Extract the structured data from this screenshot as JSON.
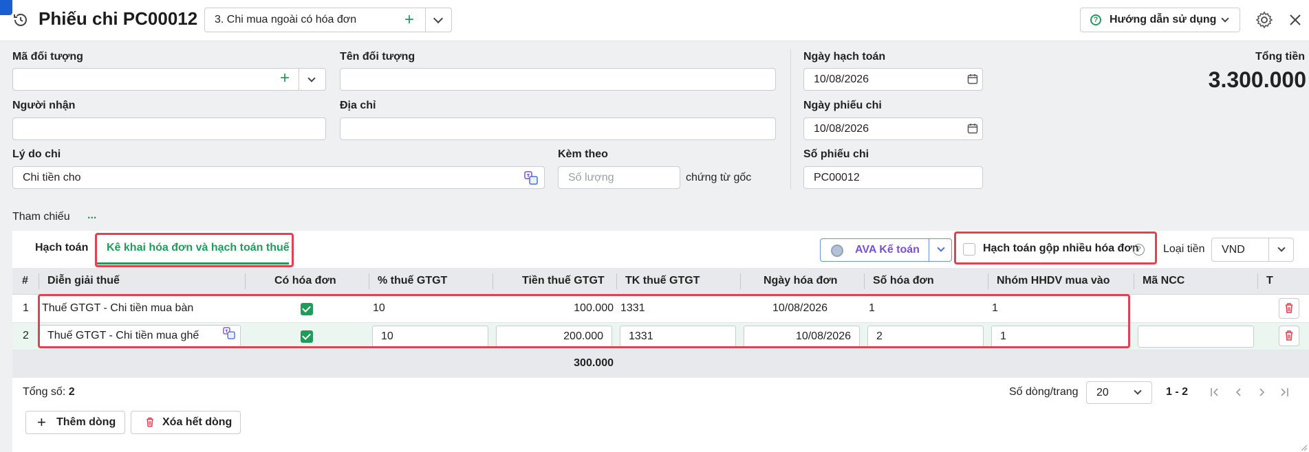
{
  "header": {
    "title": "Phiếu chi PC00012",
    "voucher_type": "3. Chi mua ngoài có hóa đơn",
    "help_label": "Hướng dẫn sử dụng"
  },
  "form": {
    "ma_doi_tuong_label": "Mã đối tượng",
    "ma_doi_tuong_value": "",
    "ten_doi_tuong_label": "Tên đối tượng",
    "ten_doi_tuong_value": "",
    "nguoi_nhan_label": "Người nhận",
    "nguoi_nhan_value": "",
    "dia_chi_label": "Địa chỉ",
    "dia_chi_value": "",
    "ly_do_chi_label": "Lý do chi",
    "ly_do_chi_value": "Chi tiền cho",
    "kem_theo_label": "Kèm theo",
    "kem_theo_placeholder": "Số lượng",
    "chung_tu_goc": "chứng từ gốc",
    "ngay_hach_toan_label": "Ngày hạch toán",
    "ngay_hach_toan_value": "10/08/2026",
    "ngay_phieu_chi_label": "Ngày phiếu chi",
    "ngay_phieu_chi_value": "10/08/2026",
    "so_phieu_chi_label": "Số phiếu chi",
    "so_phieu_chi_value": "PC00012",
    "tong_tien_label": "Tổng tiền",
    "tong_tien_value": "3.300.000",
    "tham_chieu_label": "Tham chiếu",
    "tham_chieu_more": "..."
  },
  "tabs": {
    "hach_toan": "Hạch toán",
    "ke_khai": "Kê khai hóa đơn và hạch toán thuế"
  },
  "toolbar": {
    "ava_label": "AVA Kế toán",
    "gop_label": "Hạch toán gộp nhiều hóa đơn",
    "loai_tien_label": "Loại tiền",
    "loai_tien_value": "VND"
  },
  "table": {
    "headers": {
      "stt": "#",
      "dien_giai": "Diễn giải thuế",
      "co_hoa_don": "Có hóa đơn",
      "pct_thue": "% thuế GTGT",
      "tien_thue": "Tiền thuế GTGT",
      "tk_thue": "TK thuế GTGT",
      "ngay_hd": "Ngày hóa đơn",
      "so_hd": "Số hóa đơn",
      "nhom_hhdv": "Nhóm HHDV mua vào",
      "ma_ncc": "Mã NCC",
      "more": "T"
    },
    "rows": [
      {
        "stt": "1",
        "dien_giai": "Thuế GTGT - Chi tiền mua bàn",
        "pct": "10",
        "tien": "100.000",
        "tk": "1331",
        "ngay": "10/08/2026",
        "so_hd": "1",
        "nhom": "1",
        "ma_ncc": ""
      },
      {
        "stt": "2",
        "dien_giai": "Thuế GTGT - Chi tiền mua ghế",
        "pct": "10",
        "tien": "200.000",
        "tk": "1331",
        "ngay": "10/08/2026",
        "so_hd": "2",
        "nhom": "1",
        "ma_ncc": ""
      }
    ],
    "footer_total": "300.000"
  },
  "footer": {
    "tong_so_label": "Tổng số:",
    "tong_so_value": "2",
    "page_size_label": "Số dòng/trang",
    "page_size_value": "20",
    "page_range": "1 - 2",
    "add_row": "Thêm dòng",
    "delete_all": "Xóa hết dòng"
  },
  "colors": {
    "accent_green": "#1f9c5a",
    "highlight_red": "#e0424f",
    "ava_purple": "#7b4fd6"
  }
}
